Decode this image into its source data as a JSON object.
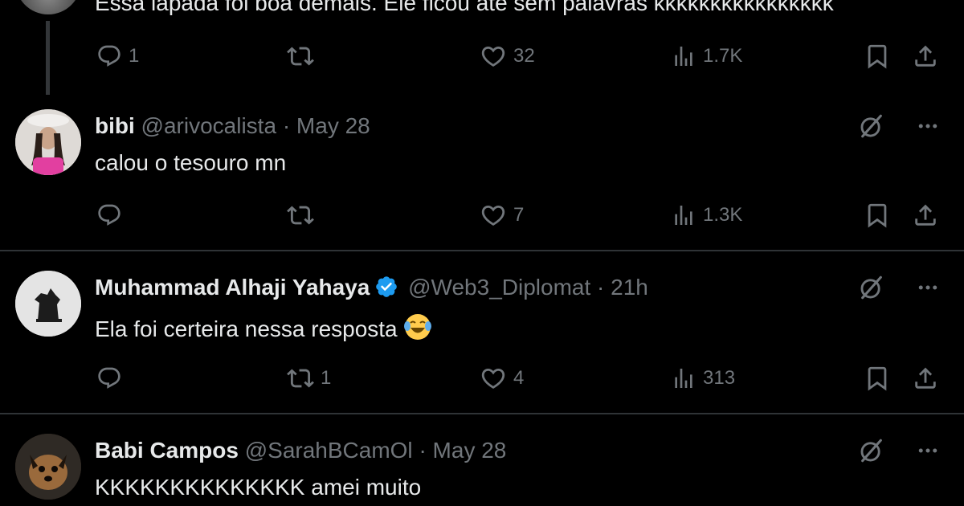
{
  "tweets": [
    {
      "text": "Essa lapada foi boa demais. Ele ficou até sem palavras kkkkkkkkkkkkkkkk",
      "replies": "1",
      "reposts": "",
      "likes": "32",
      "views": "1.7K"
    },
    {
      "name": "bibi",
      "handle": "@arivocalista",
      "sep": "·",
      "time": "May 28",
      "text": "calou o tesouro mn",
      "replies": "",
      "reposts": "",
      "likes": "7",
      "views": "1.3K"
    },
    {
      "name": "Muhammad Alhaji Yahaya",
      "handle": "@Web3_Diplomat",
      "sep": "·",
      "time": "21h",
      "text": "Ela foi certeira nessa resposta",
      "emoji": "face-with-tears-of-joy",
      "verified": true,
      "replies": "",
      "reposts": "1",
      "likes": "4",
      "views": "313"
    },
    {
      "name": "Babi Campos",
      "handle": "@SarahBCamOl",
      "sep": "·",
      "time": "May 28",
      "text": "KKKKKKKKKKKKKK amei muito"
    }
  ],
  "colors": {
    "background": "#000000",
    "text": "#e7e9ea",
    "muted": "#71767b",
    "divider": "#2f3336",
    "verified": "#1d9bf0"
  },
  "icons": [
    "reply-icon",
    "repost-icon",
    "like-icon",
    "views-icon",
    "bookmark-icon",
    "share-icon",
    "grok-icon",
    "more-icon",
    "verified-badge-icon"
  ]
}
